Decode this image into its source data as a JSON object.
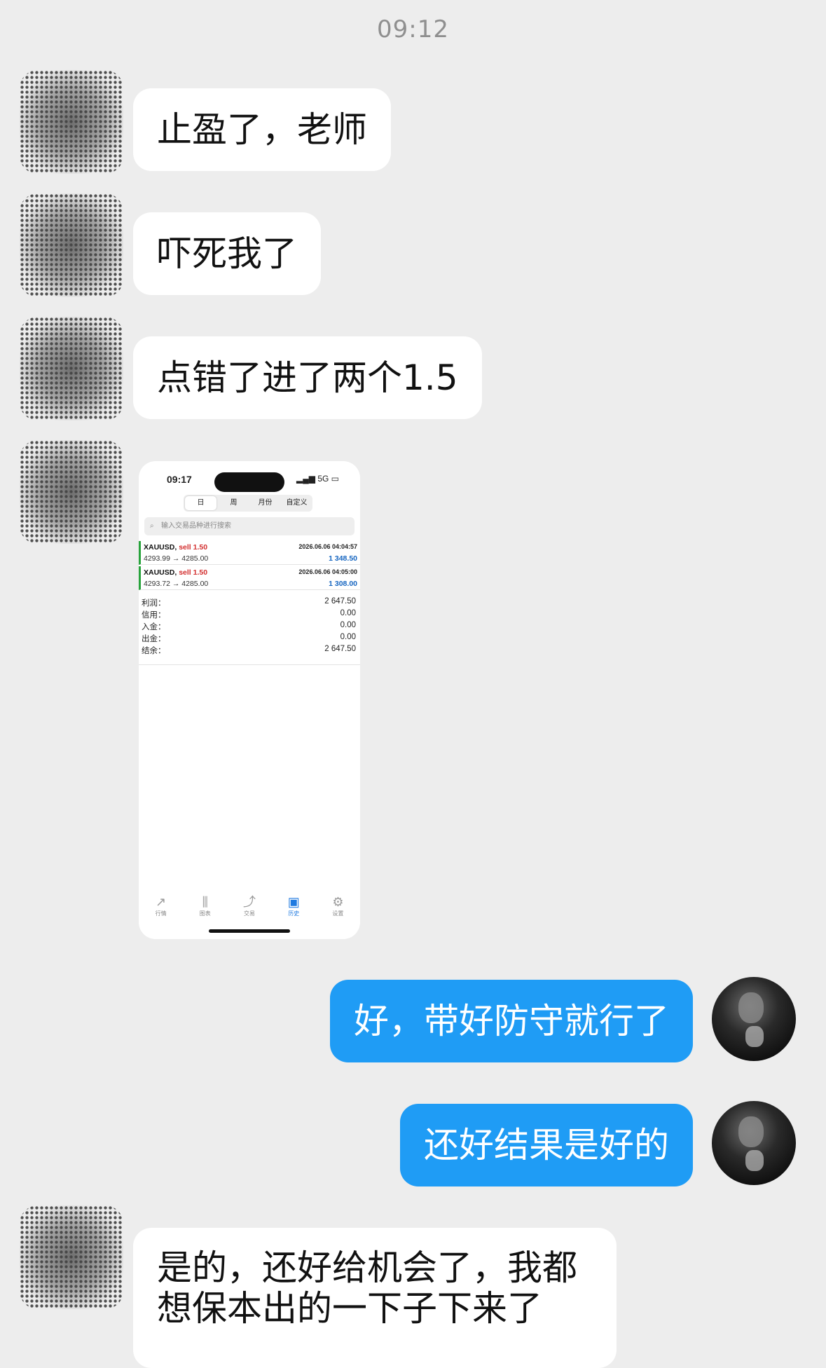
{
  "timestamp": "09:12",
  "messages": [
    {
      "side": "left",
      "text": "止盈了，老师"
    },
    {
      "side": "left",
      "text": "吓死我了"
    },
    {
      "side": "left",
      "text": "点错了进了两个1.5"
    },
    {
      "side": "right",
      "text": "好，带好防守就行了"
    },
    {
      "side": "right",
      "text": "还好结果是好的"
    },
    {
      "side": "left",
      "text": "是的，还好给机会了，我都"
    },
    {
      "side": "left",
      "text": "想保本出的一下子下来了"
    }
  ],
  "screenshot": {
    "time": "09:17",
    "network": "5G",
    "periods": [
      "日",
      "周",
      "月份",
      "自定义"
    ],
    "search_placeholder": "输入交易品种进行搜索",
    "trades": [
      {
        "symbol": "XAUUSD,",
        "side": "sell 1.50",
        "prices": "4293.99 → 4285.00",
        "datetime": "2026.06.06 04:04:57",
        "profit": "1 348.50"
      },
      {
        "symbol": "XAUUSD,",
        "side": "sell 1.50",
        "prices": "4293.72 → 4285.00",
        "datetime": "2026.06.06 04:05:00",
        "profit": "1 308.00"
      }
    ],
    "summary": [
      {
        "label": "利润：",
        "value": "2 647.50"
      },
      {
        "label": "信用：",
        "value": "0.00"
      },
      {
        "label": "入金：",
        "value": "0.00"
      },
      {
        "label": "出金：",
        "value": "0.00"
      },
      {
        "label": "结余：",
        "value": "2 647.50"
      }
    ],
    "tabs": [
      {
        "label": "行情",
        "icon": "trend-icon"
      },
      {
        "label": "图表",
        "icon": "candlestick-icon"
      },
      {
        "label": "交易",
        "icon": "trade-icon"
      },
      {
        "label": "历史",
        "icon": "inbox-icon"
      },
      {
        "label": "设置",
        "icon": "gear-icon"
      }
    ]
  },
  "colors": {
    "background": "#ededed",
    "bubble_right": "#1f9cf5",
    "bubble_left": "#ffffff",
    "profit": "#1565c0",
    "sell": "#d32f2f"
  }
}
